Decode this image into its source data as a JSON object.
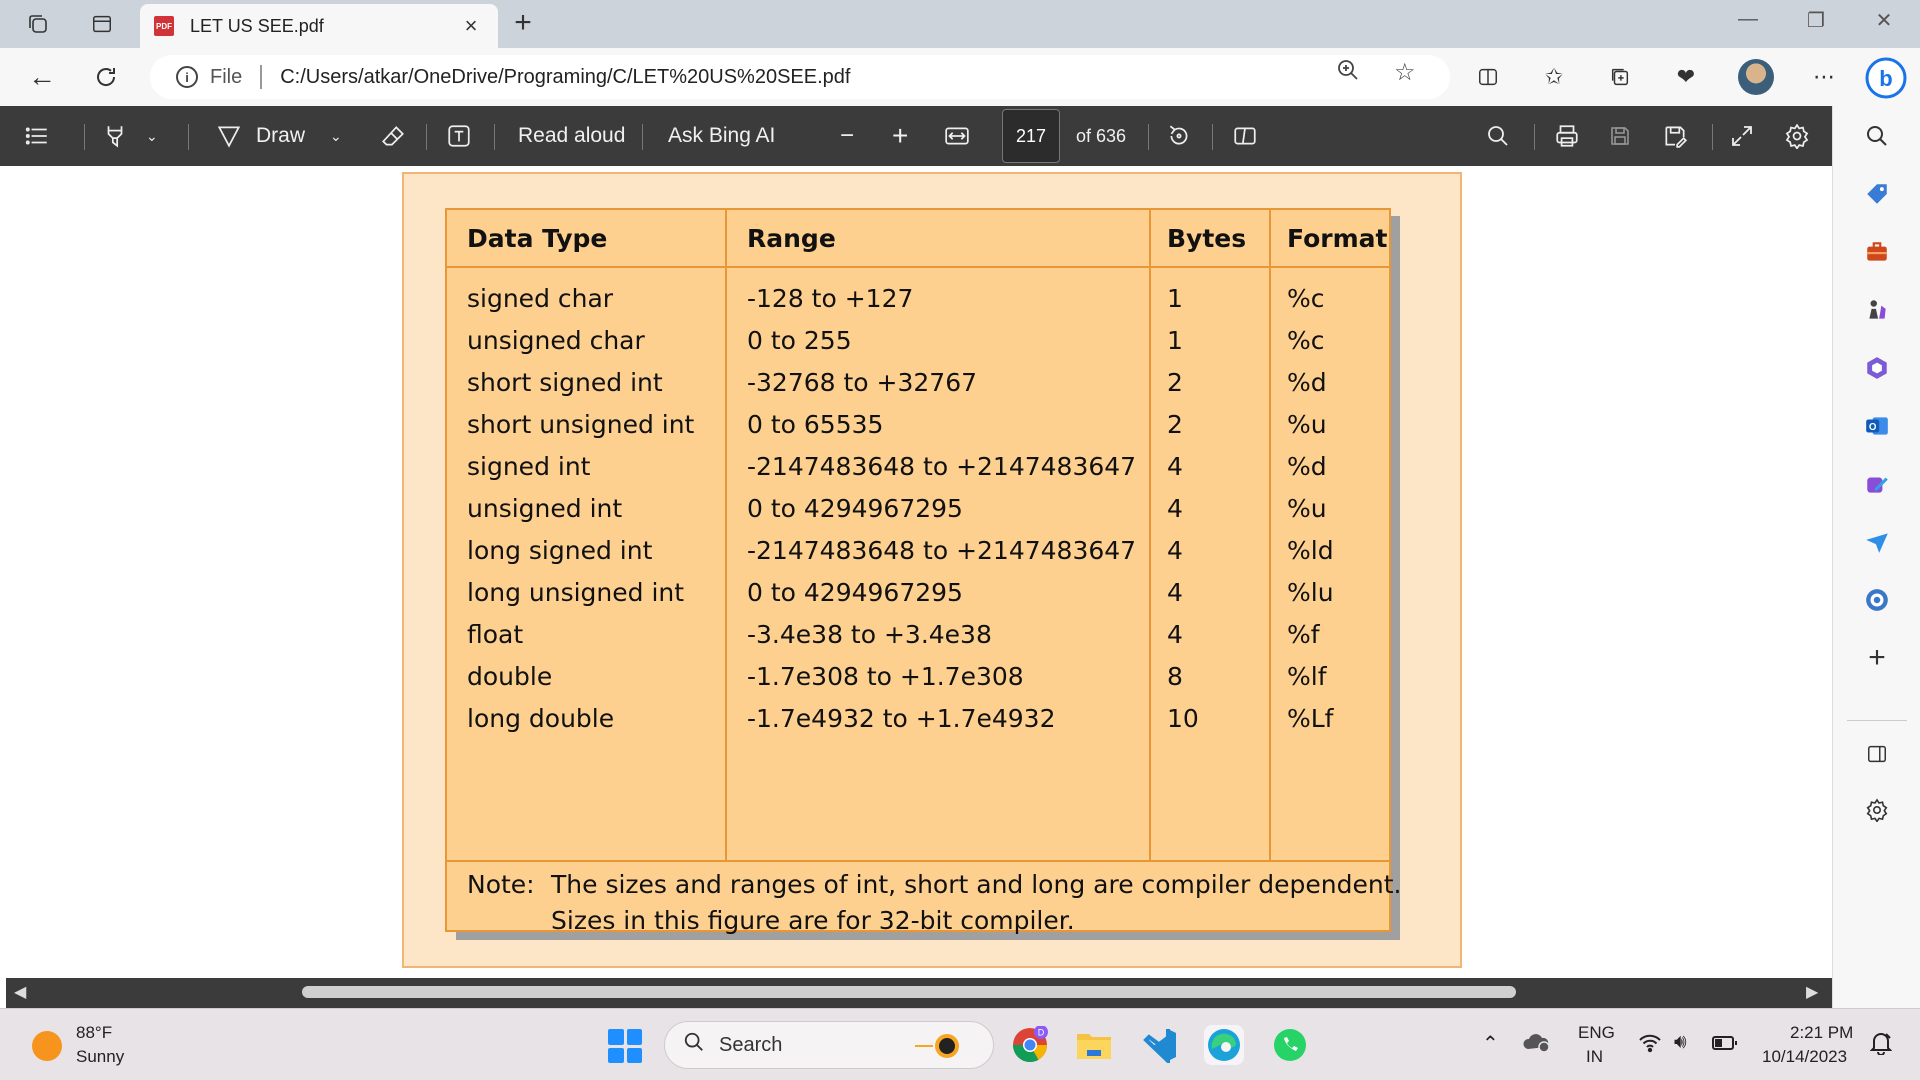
{
  "tab": {
    "title": "LET US SEE.pdf",
    "badge": "PDF"
  },
  "address": {
    "scheme_label": "File",
    "url": "C:/Users/atkar/OneDrive/Programing/C/LET%20US%20SEE.pdf"
  },
  "pdf_toolbar": {
    "draw_label": "Draw",
    "read_aloud_label": "Read aloud",
    "ask_bing_label": "Ask Bing AI",
    "page_current": "217",
    "page_total": "of 636"
  },
  "table": {
    "headers": [
      "Data Type",
      "Range",
      "Bytes",
      "Format"
    ],
    "rows": [
      {
        "type": "signed char",
        "range": "-128  to  +127",
        "bytes": "1",
        "format": "%c"
      },
      {
        "type": "unsigned char",
        "range": "0  to  255",
        "bytes": "1",
        "format": "%c"
      },
      {
        "type": "short signed int",
        "range": "-32768  to  +32767",
        "bytes": "2",
        "format": "%d"
      },
      {
        "type": "short unsigned int",
        "range": "0  to  65535",
        "bytes": "2",
        "format": "%u"
      },
      {
        "type": "signed int",
        "range": "-2147483648  to  +2147483647",
        "bytes": "4",
        "format": "%d"
      },
      {
        "type": "unsigned int",
        "range": "0  to  4294967295",
        "bytes": "4",
        "format": "%u"
      },
      {
        "type": "long signed int",
        "range": "-2147483648  to  +2147483647",
        "bytes": "4",
        "format": "%ld"
      },
      {
        "type": "long unsigned int",
        "range": "0  to  4294967295",
        "bytes": "4",
        "format": "%lu"
      },
      {
        "type": "float",
        "range": "-3.4e38  to +3.4e38",
        "bytes": "4",
        "format": "%f"
      },
      {
        "type": "double",
        "range": "-1.7e308  to  +1.7e308",
        "bytes": "8",
        "format": "%lf"
      },
      {
        "type": "long double",
        "range": "-1.7e4932  to  +1.7e4932",
        "bytes": "10",
        "format": "%Lf"
      }
    ],
    "note_label": "Note:",
    "note_line1": "The sizes and ranges of int, short and long are compiler dependent.",
    "note_line2": "Sizes in this figure are for 32-bit compiler."
  },
  "taskbar": {
    "temperature": "88°F",
    "weather": "Sunny",
    "search_label": "Search",
    "lang_top": "ENG",
    "lang_bottom": "IN",
    "time": "2:21 PM",
    "date": "10/14/2023",
    "chrome_badge": "D"
  },
  "colors": {
    "table_fill": "#fdd090",
    "table_border": "#e79735",
    "page_bg": "#fde5c8",
    "toolbar_bg": "#3b3b3b"
  }
}
